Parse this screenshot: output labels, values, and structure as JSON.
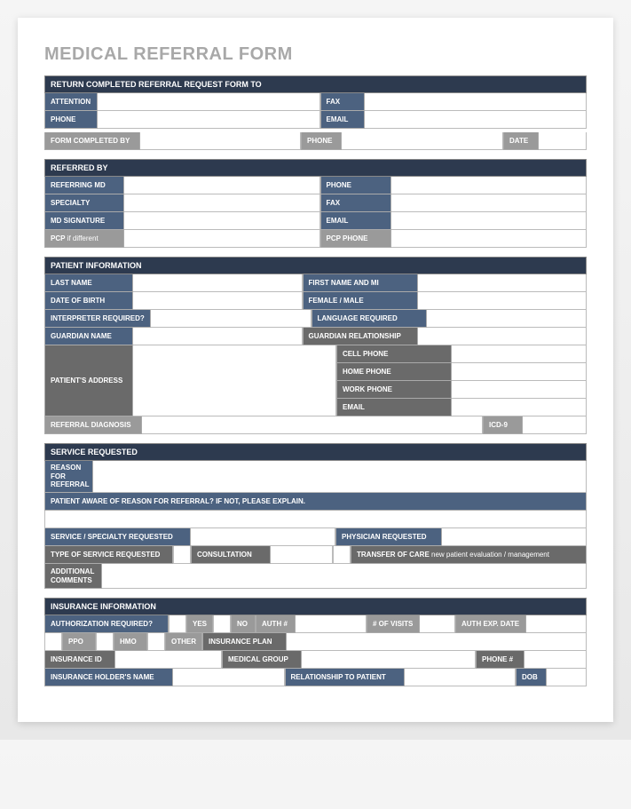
{
  "title": "MEDICAL REFERRAL FORM",
  "s1": {
    "header": "RETURN COMPLETED REFERRAL REQUEST FORM TO",
    "attention": "ATTENTION",
    "fax": "FAX",
    "phone": "PHONE",
    "email": "EMAIL",
    "completed_by": "FORM COMPLETED BY",
    "phone2": "PHONE",
    "date": "DATE"
  },
  "s2": {
    "header": "REFERRED BY",
    "referring_md": "REFERRING MD",
    "phone": "PHONE",
    "specialty": "SPECIALTY",
    "fax": "FAX",
    "md_signature": "MD SIGNATURE",
    "email": "EMAIL",
    "pcp": "PCP",
    "pcp_note": " if different",
    "pcp_phone": "PCP PHONE"
  },
  "s3": {
    "header": "PATIENT INFORMATION",
    "last_name": "LAST NAME",
    "first_name": "FIRST NAME AND MI",
    "dob": "DATE OF BIRTH",
    "sex": "FEMALE / MALE",
    "interpreter": "INTERPRETER REQUIRED?",
    "language": "LANGUAGE REQUIRED",
    "guardian_name": "GUARDIAN NAME",
    "guardian_rel": "GUARDIAN RELATIONSHIP",
    "address": "PATIENT'S ADDRESS",
    "cell": "CELL PHONE",
    "home": "HOME PHONE",
    "work": "WORK PHONE",
    "email": "EMAIL",
    "diagnosis": "REFERRAL DIAGNOSIS",
    "icd9": "ICD-9"
  },
  "s4": {
    "header": "SERVICE REQUESTED",
    "reason": "REASON\nFOR\nREFERRAL",
    "aware": "PATIENT AWARE OF REASON FOR REFERRAL? IF NOT, PLEASE EXPLAIN.",
    "service_specialty": "SERVICE / SPECIALTY REQUESTED",
    "physician": "PHYSICIAN REQUESTED",
    "type": "TYPE OF SERVICE REQUESTED",
    "consultation": "CONSULTATION",
    "transfer": "TRANSFER OF CARE",
    "transfer_note": " new patient evaluation / management",
    "additional": "ADDITIONAL\nCOMMENTS"
  },
  "s5": {
    "header": "INSURANCE INFORMATION",
    "auth_required": "AUTHORIZATION REQUIRED?",
    "yes": "YES",
    "no": "NO",
    "auth_num": "AUTH #",
    "visits": "# OF VISITS",
    "auth_exp": "AUTH EXP. DATE",
    "ppo": "PPO",
    "hmo": "HMO",
    "other": "OTHER",
    "plan": "INSURANCE PLAN",
    "ins_id": "INSURANCE ID",
    "med_group": "MEDICAL GROUP",
    "phone": "PHONE #",
    "holder": "INSURANCE HOLDER'S NAME",
    "relationship": "RELATIONSHIP TO PATIENT",
    "dob": "DOB"
  }
}
